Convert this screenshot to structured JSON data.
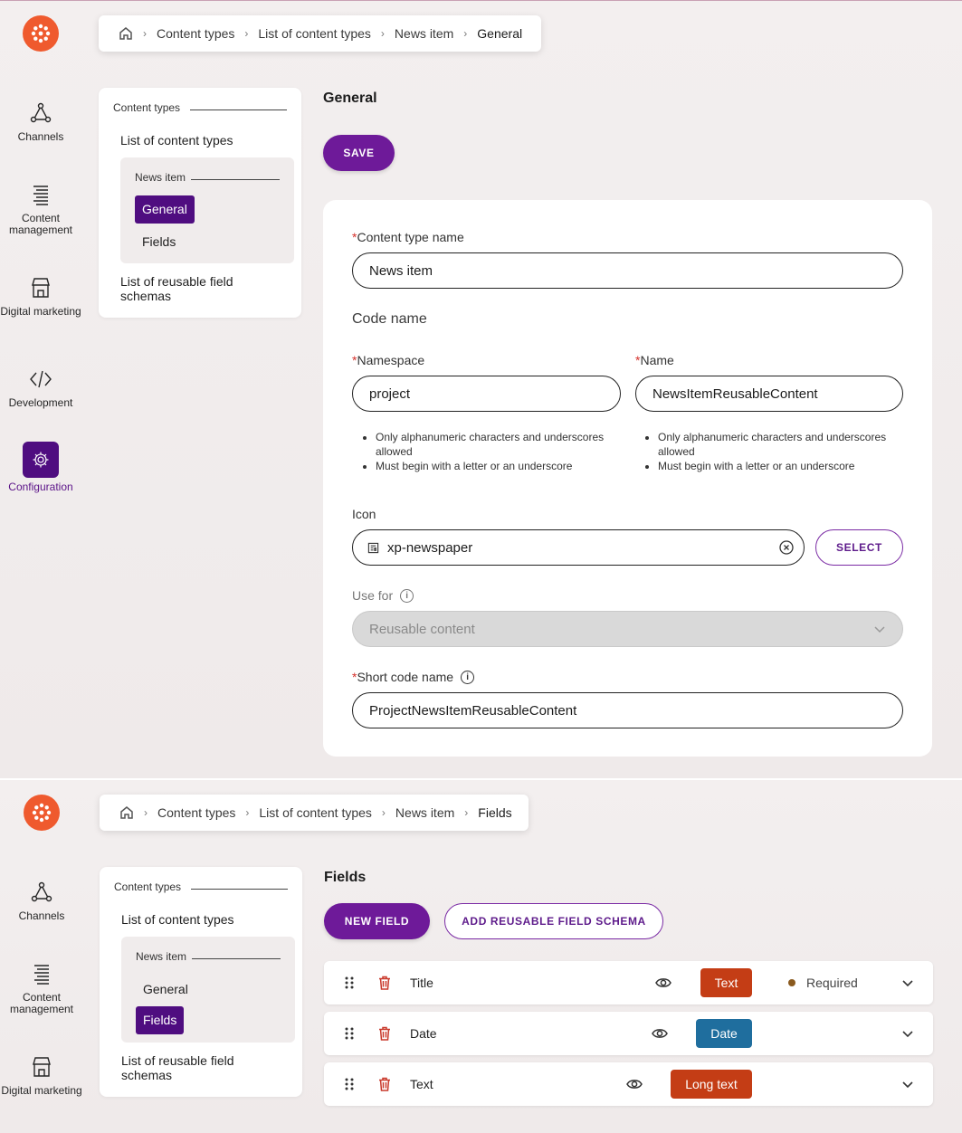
{
  "colors": {
    "accent": "#4f0d80",
    "primary_button": "#6e1a99",
    "logo": "#ef5a2e",
    "badge_text": "#c43d15",
    "badge_date": "#1f6e9e",
    "badge_long_text": "#c43d15",
    "required_dot": "#8a5a1e",
    "required_asterisk": "#d4302b"
  },
  "nav": {
    "channels": "Channels",
    "content_management": "Content management",
    "digital_marketing": "Digital marketing",
    "development": "Development",
    "configuration": "Configuration"
  },
  "screen_general": {
    "breadcrumb": [
      "Content types",
      "List of content types",
      "News item",
      "General"
    ],
    "tree": {
      "group_label": "Content types",
      "list_item": "List of content types",
      "sub_group_label": "News item",
      "sub_items": [
        "General",
        "Fields"
      ],
      "selected": "General",
      "reusable": "List of reusable field schemas"
    },
    "title": "General",
    "save_button": "SAVE",
    "form": {
      "content_type_name_label": "Content type name",
      "content_type_name_value": "News item",
      "code_name_heading": "Code name",
      "namespace_label": "Namespace",
      "namespace_value": "project",
      "name_label": "Name",
      "name_value": "NewsItemReusableContent",
      "hints": [
        "Only alphanumeric characters and underscores allowed",
        "Must begin with a letter or an underscore"
      ],
      "icon_label": "Icon",
      "icon_value": "xp-newspaper",
      "select_button": "SELECT",
      "use_for_label": "Use for",
      "use_for_value": "Reusable content",
      "short_code_name_label": "Short code name",
      "short_code_name_value": "ProjectNewsItemReusableContent"
    }
  },
  "screen_fields": {
    "breadcrumb": [
      "Content types",
      "List of content types",
      "News item",
      "Fields"
    ],
    "tree": {
      "group_label": "Content types",
      "list_item": "List of content types",
      "sub_group_label": "News item",
      "sub_items": [
        "General",
        "Fields"
      ],
      "selected": "Fields",
      "reusable": "List of reusable field schemas"
    },
    "title": "Fields",
    "new_field_button": "NEW FIELD",
    "add_schema_button": "ADD REUSABLE FIELD SCHEMA",
    "fields": [
      {
        "name": "Title",
        "type": "Text",
        "required": "Required"
      },
      {
        "name": "Date",
        "type": "Date"
      },
      {
        "name": "Text",
        "type": "Long text"
      }
    ]
  }
}
